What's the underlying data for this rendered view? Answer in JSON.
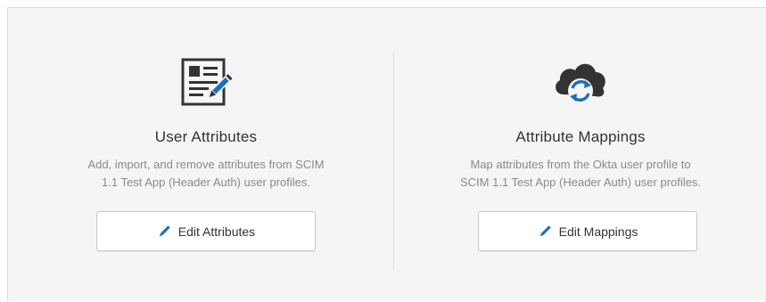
{
  "colors": {
    "accent": "#1f6fbf",
    "icon_dark": "#333333",
    "panel_bg": "#f5f5f5"
  },
  "user_attributes": {
    "icon": "profile-edit-icon",
    "title": "User Attributes",
    "description_line1": "Add, import, and remove attributes from SCIM",
    "description_line2": "1.1 Test App (Header Auth) user profiles.",
    "button_label": "Edit Attributes",
    "button_icon": "pencil-icon"
  },
  "attribute_mappings": {
    "icon": "cloud-sync-icon",
    "title": "Attribute Mappings",
    "description_line1": "Map attributes from the Okta user profile to",
    "description_line2": "SCIM 1.1 Test App (Header Auth) user profiles.",
    "button_label": "Edit Mappings",
    "button_icon": "pencil-icon"
  }
}
